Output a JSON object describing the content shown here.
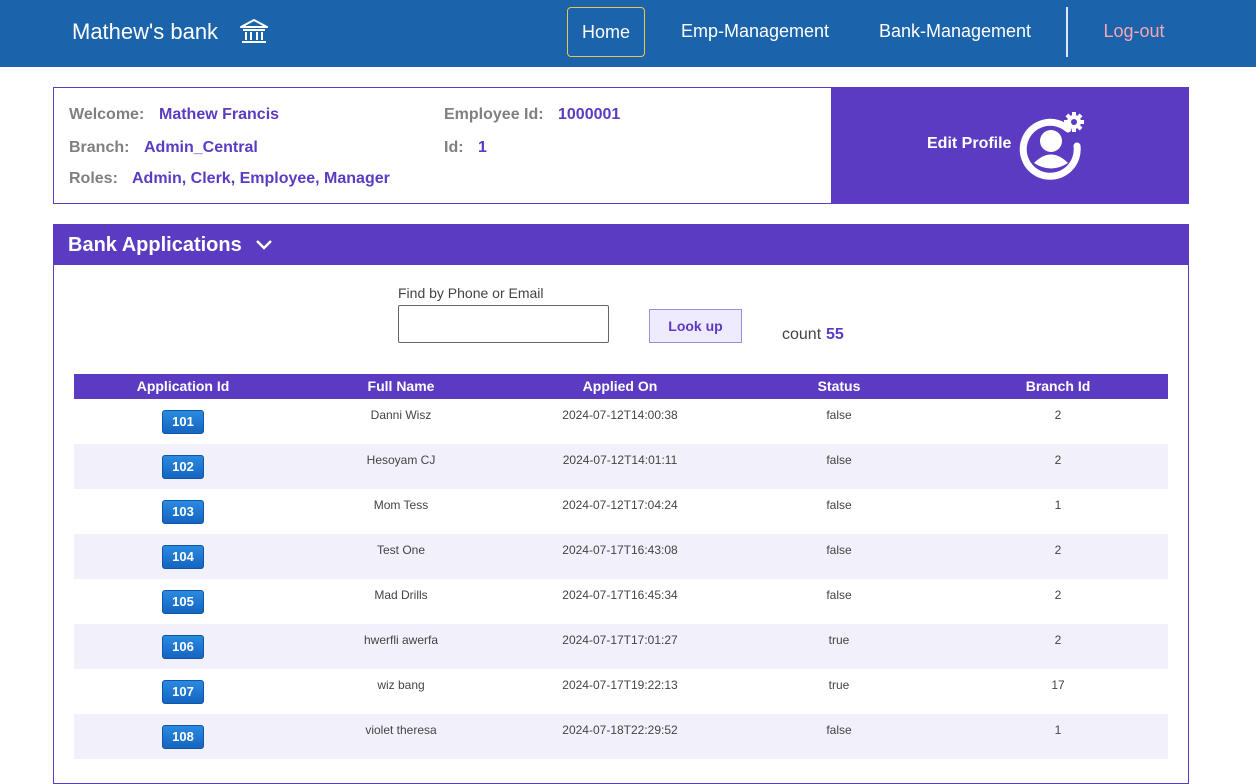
{
  "nav": {
    "brand": "Mathew's bank",
    "brand_icon": "bank-icon",
    "links": [
      "Home",
      "Emp-Management",
      "Bank-Management"
    ],
    "logout": "Log-out",
    "active": "Home"
  },
  "profile": {
    "welcome_label": "Welcome:",
    "welcome_value": "Mathew Francis",
    "employee_id_label": "Employee Id:",
    "employee_id_value": "1000001",
    "branch_label": "Branch:",
    "branch_value": "Admin_Central",
    "id_label": "Id:",
    "id_value": "1",
    "roles_label": "Roles:",
    "roles_value": "Admin, Clerk, Employee, Manager",
    "edit_label": "Edit Profile",
    "edit_icon": "user-gear-icon"
  },
  "applications": {
    "title": "Bank Applications",
    "find_label": "Find by Phone or Email",
    "find_value": "",
    "lookup_label": "Look up",
    "count_label": "count",
    "count_value": "55",
    "columns": [
      "Application Id",
      "Full Name",
      "Applied On",
      "Status",
      "Branch Id"
    ],
    "rows": [
      {
        "id": "101",
        "name": "Danni Wisz",
        "applied": "2024-07-12T14:00:38",
        "status": "false",
        "branch": "2"
      },
      {
        "id": "102",
        "name": "Hesoyam CJ",
        "applied": "2024-07-12T14:01:11",
        "status": "false",
        "branch": "2"
      },
      {
        "id": "103",
        "name": "Mom Tess",
        "applied": "2024-07-12T17:04:24",
        "status": "false",
        "branch": "1"
      },
      {
        "id": "104",
        "name": "Test One",
        "applied": "2024-07-17T16:43:08",
        "status": "false",
        "branch": "2"
      },
      {
        "id": "105",
        "name": "Mad Drills",
        "applied": "2024-07-17T16:45:34",
        "status": "false",
        "branch": "2"
      },
      {
        "id": "106",
        "name": "hwerfli awerfa",
        "applied": "2024-07-17T17:01:27",
        "status": "true",
        "branch": "2"
      },
      {
        "id": "107",
        "name": "wiz bang",
        "applied": "2024-07-17T19:22:13",
        "status": "true",
        "branch": "17"
      },
      {
        "id": "108",
        "name": "violet theresa",
        "applied": "2024-07-18T22:29:52",
        "status": "false",
        "branch": "1"
      }
    ]
  },
  "colors": {
    "nav_bg": "#1b63aa",
    "accent": "#5c3bc3",
    "logout": "#f4a6b2",
    "app_button": "#1a73d1"
  }
}
